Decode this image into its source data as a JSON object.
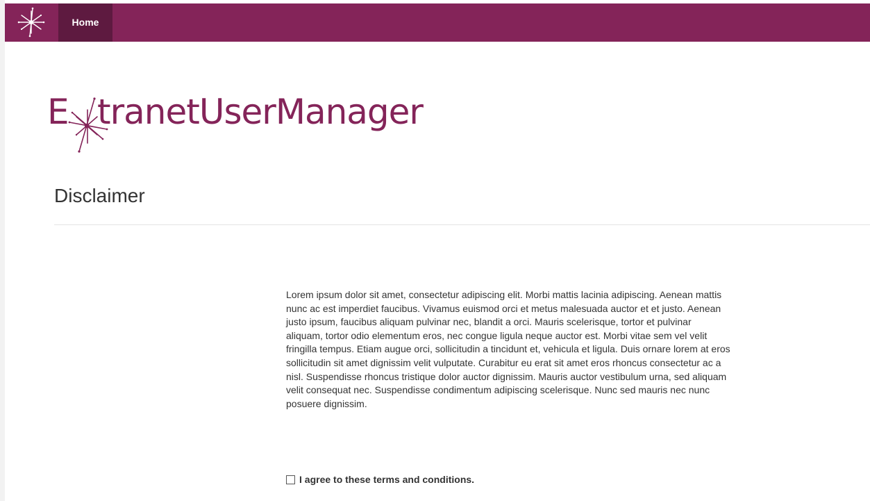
{
  "nav": {
    "logo_icon": "starburst-logo-icon",
    "home_label": "Home",
    "background": "#842459",
    "active_background": "#5e1a40"
  },
  "brand": {
    "logo_text_first": "E",
    "logo_text_rest": "tranetUserManager",
    "logo_mark": "starburst-x-icon",
    "color": "#842459"
  },
  "page": {
    "title": "Disclaimer"
  },
  "disclaimer": {
    "body": "Lorem ipsum dolor sit amet, consectetur adipiscing elit. Morbi mattis lacinia adipiscing. Aenean mattis nunc ac est imperdiet faucibus. Vivamus euismod orci et metus malesuada auctor et et justo. Aenean justo ipsum, faucibus aliquam pulvinar nec, blandit a orci. Mauris scelerisque, tortor et pulvinar aliquam, tortor odio elementum eros, nec congue ligula neque auctor est. Morbi vitae sem vel velit fringilla tempus. Etiam augue orci, sollicitudin a tincidunt et, vehicula et ligula. Duis ornare lorem at eros sollicitudin sit amet dignissim velit vulputate. Curabitur eu erat sit amet eros rhoncus consectetur ac a nisl. Suspendisse rhoncus tristique dolor auctor dignissim. Mauris auctor vestibulum urna, sed aliquam velit consequat nec. Suspendisse condimentum adipiscing scelerisque. Nunc sed mauris nec nunc posuere dignissim.",
    "agree_label": "I agree to these terms and conditions.",
    "agree_checked": false
  }
}
